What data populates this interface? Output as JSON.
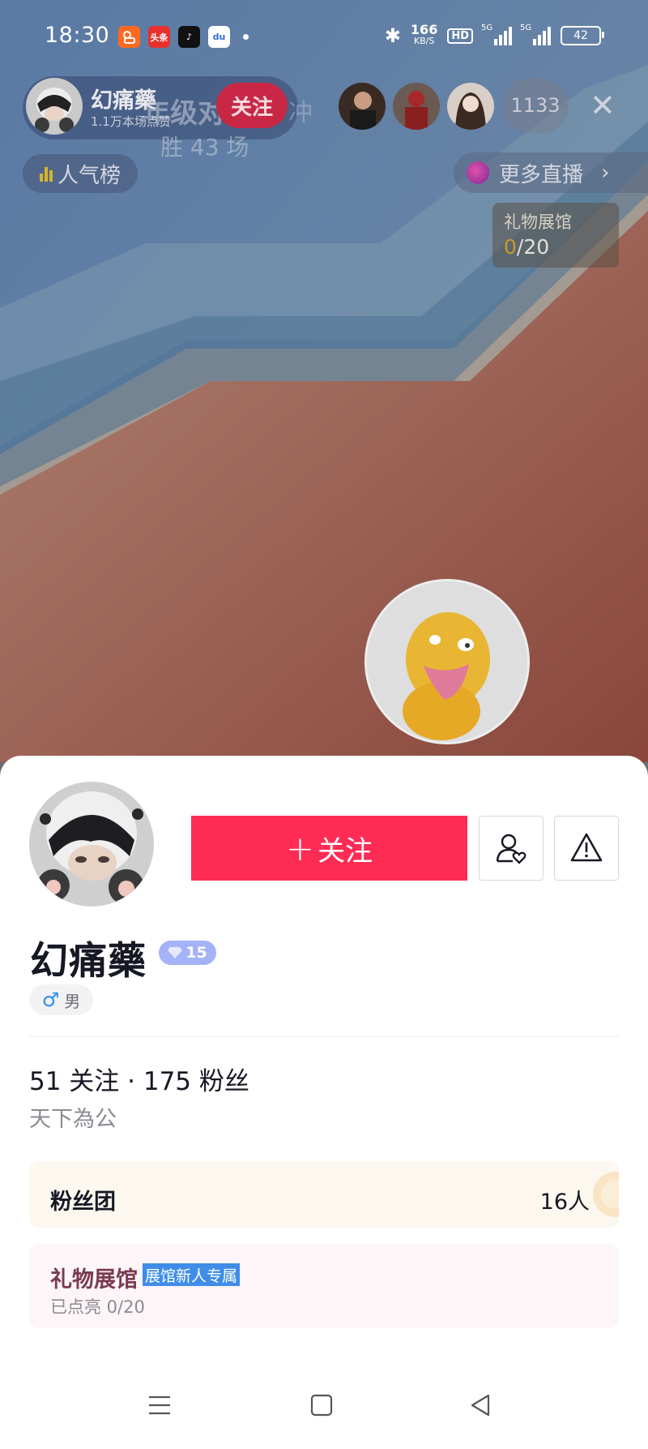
{
  "status_bar": {
    "time": "18:30",
    "app_icons": [
      {
        "name": "kuaishou-icon",
        "label": "",
        "color": "#ff6a1f"
      },
      {
        "name": "toutiao-icon",
        "label": "头条",
        "color": "#e8302c"
      },
      {
        "name": "tiktok-icon",
        "label": "♪",
        "color": "#111111"
      },
      {
        "name": "baidu-icon",
        "label": "du",
        "color": "#2f6be0"
      }
    ],
    "speed_value": "166",
    "speed_unit": "KB/S",
    "hd_label": "HD",
    "signal1_label": "5G",
    "signal2_label": "5G",
    "battery": "42"
  },
  "live_header": {
    "host_name": "幻痛藥",
    "host_sub": "1.1万本场点赞",
    "follow_label": "关注",
    "ghost_line1": "年级对",
    "ghost_line2": "胜 43 场",
    "ghost_right": "冲",
    "viewer_count": "1133",
    "close_label": "✕",
    "rank_label": "人气榜",
    "more_live_label": "更多直播",
    "gift_hall_title": "礼物展馆",
    "gift_hall_lit": "0",
    "gift_hall_total": "/20"
  },
  "profile": {
    "follow_button_label": "关注",
    "follow_plus": "+",
    "name": "幻痛藥",
    "level": "15",
    "gender_symbol": "♂",
    "gender_label": "男",
    "stats": "51 关注 · 175 粉丝",
    "signature": "天下為公"
  },
  "fan_club": {
    "title": "粉丝团",
    "count": "16人"
  },
  "gift_hall": {
    "title": "礼物展馆",
    "tag": "展馆新人专属",
    "progress_text": "已点亮  0/20"
  },
  "colors": {
    "follow_red": "#fe2c55",
    "level_blue": "#a4b2f7",
    "tag_blue": "#3f8de8"
  }
}
